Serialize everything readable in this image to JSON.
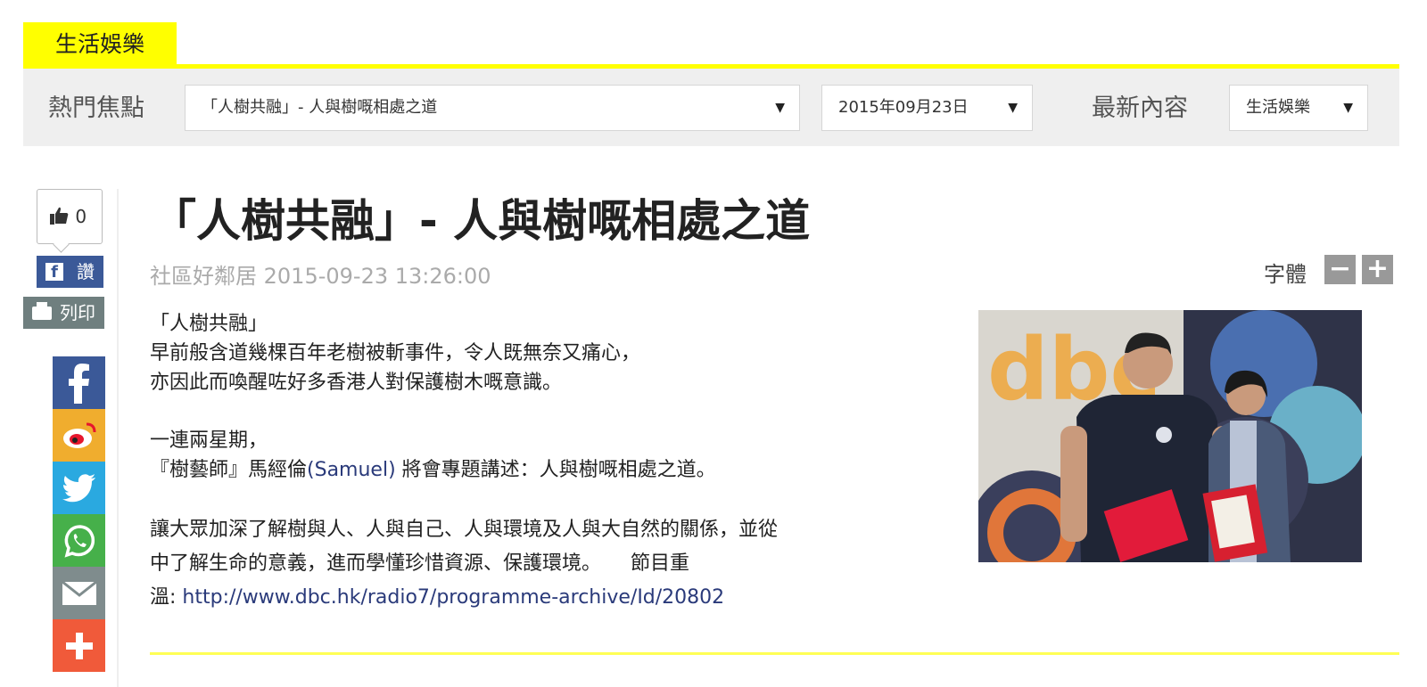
{
  "section": {
    "tab_label": "生活娛樂"
  },
  "filters": {
    "hot_topics_label": "熱門焦點",
    "topic_select_value": "「人樹共融」- 人與樹嘅相處之道",
    "date_select_value": "2015年09月23日",
    "latest_label": "最新內容",
    "category_select_value": "生活娛樂"
  },
  "social": {
    "like_count": "0",
    "fb_say_label": "讚",
    "print_label": "列印",
    "share_buttons": [
      {
        "name": "facebook",
        "color": "#3b5998"
      },
      {
        "name": "weibo",
        "color": "#f0ad2e"
      },
      {
        "name": "twitter",
        "color": "#2aa9e0"
      },
      {
        "name": "whatsapp",
        "color": "#46b04a"
      },
      {
        "name": "email",
        "color": "#7f8c8d"
      },
      {
        "name": "more",
        "color": "#f05a3a"
      }
    ]
  },
  "article": {
    "title": "「人樹共融」- 人與樹嘅相處之道",
    "author": "社區好鄰居",
    "datetime": "2015-09-23 13:26:00",
    "font_label": "字體",
    "font_minus": "−",
    "font_plus": "+",
    "paragraphs": {
      "p1_line1": "「人樹共融」",
      "p1_line2": "早前般含道幾棵百年老樹被斬事件，令人既無奈又痛心，",
      "p1_line3": "亦因此而喚醒咗好多香港人對保護樹木嘅意識。",
      "p2_line1": "一連兩星期，",
      "p2_line2_a": "『樹藝師』馬經倫",
      "p2_line2_b": "(Samuel)",
      "p2_line2_c": " 將會專題講述：人與樹嘅相處之道。",
      "p3_line1": "讓大眾加深了解樹與人、人與自己、人與環境及人與大自然的關係，並從",
      "p3_line2": "中了解生命的意義，進而學懂珍惜資源、保護環境。　　節目重",
      "p3_line3_a": "溫: ",
      "p3_line3_b": "http://www.dbc.hk/radio7/programme-archive/Id/20802"
    },
    "photo_logo_text": "dbc"
  },
  "colors": {
    "accent_yellow": "#ffff00",
    "bar_gray": "#efefef",
    "facebook": "#3b5998"
  }
}
